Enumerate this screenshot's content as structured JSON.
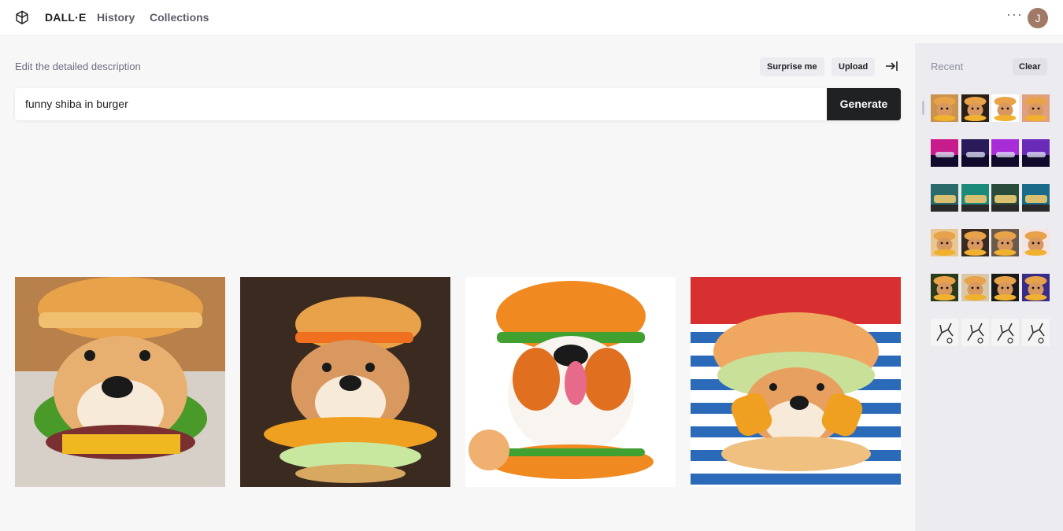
{
  "header": {
    "brand": "DALL·E",
    "nav": {
      "history": "History",
      "collections": "Collections"
    },
    "more": "···",
    "avatar_initial": "J"
  },
  "editor": {
    "label": "Edit the detailed description",
    "surprise_label": "Surprise me",
    "upload_label": "Upload",
    "prompt_value": "funny shiba in burger",
    "generate_label": "Generate"
  },
  "results": [
    {
      "subject": "shiba-in-burger",
      "bg": "#c28a56"
    },
    {
      "subject": "shiba-in-burger",
      "bg": "#3b2a20"
    },
    {
      "subject": "shiba-in-burger",
      "bg": "#ffffff"
    },
    {
      "subject": "shiba-in-burger",
      "bg": "#d83030"
    }
  ],
  "sidebar": {
    "recent_label": "Recent",
    "clear_label": "Clear",
    "thumbnail_rows": [
      {
        "theme": "shiba-burger",
        "colors": [
          "#c9934e",
          "#2a2015",
          "#ffffff",
          "#e0a080"
        ]
      },
      {
        "theme": "neon-car",
        "colors": [
          "#c81c8c",
          "#2a1a5a",
          "#a82cd8",
          "#6a2ab8"
        ]
      },
      {
        "theme": "train",
        "colors": [
          "#2a6a6a",
          "#1c8a7a",
          "#2a4a3a",
          "#1a6a8a"
        ]
      },
      {
        "theme": "cat-burger",
        "colors": [
          "#e8c890",
          "#3a2a20",
          "#6a5a4a",
          "#f4e4e4"
        ]
      },
      {
        "theme": "portrait-art",
        "colors": [
          "#2a3a1a",
          "#d8c8a8",
          "#1a1a1a",
          "#3a2a8a"
        ]
      },
      {
        "theme": "robot-sketch",
        "colors": [
          "#f4f4f4",
          "#f4f4f4",
          "#f4f4f4",
          "#f4f4f4"
        ]
      }
    ]
  },
  "colors": {
    "accent": "#202123",
    "background": "#f7f7f8",
    "sidebar_bg": "#ececf0"
  }
}
